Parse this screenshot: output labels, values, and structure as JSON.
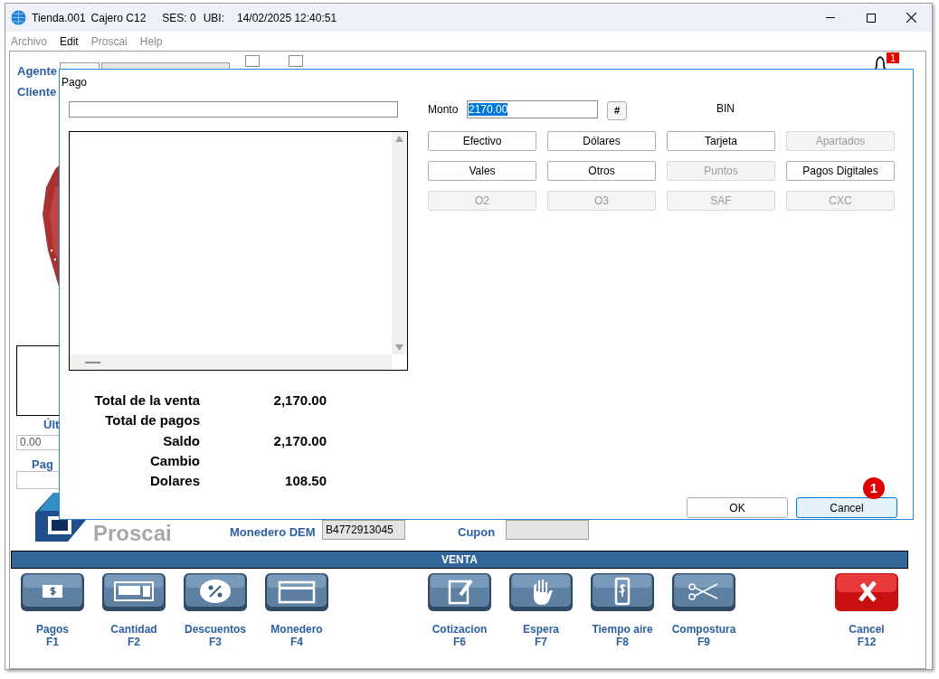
{
  "window": {
    "title_parts": [
      "Tienda.001",
      "Cajero C12",
      "SES: 0",
      "UBI:",
      "14/02/2025 12:40:51"
    ]
  },
  "menu": [
    {
      "label": "Archivo",
      "disabled": true
    },
    {
      "label": "Edit",
      "disabled": false
    },
    {
      "label": "Proscai",
      "disabled": true
    },
    {
      "label": "Help",
      "disabled": true
    }
  ],
  "header": {
    "agente_label": "Agente",
    "cliente_label": "Cliente",
    "notification_count": "1",
    "checkboxes": [
      {
        "checked": false
      },
      {
        "checked": false
      }
    ]
  },
  "side": {
    "ultimo_label": "Últ",
    "ultimo_value": "0.00",
    "pago_label": "Pag"
  },
  "logo": {
    "text": "Proscai"
  },
  "footer_fields": [
    {
      "label": "Monedero DEM",
      "value": "B4772913045"
    },
    {
      "label": "Cupon"
    }
  ],
  "section_title": "VENTA",
  "function_keys": [
    {
      "kind": "cash",
      "label": "Pagos",
      "key": "F1"
    },
    {
      "kind": "calculator",
      "label": "Cantidad",
      "key": "F2"
    },
    {
      "kind": "percent",
      "label": "Descuentos",
      "key": "F3"
    },
    {
      "kind": "card",
      "label": "Monedero",
      "key": "F4"
    },
    {
      "kind": "gap"
    },
    {
      "kind": "note",
      "label": "Cotizacion",
      "key": "F6"
    },
    {
      "kind": "hand",
      "label": "Espera",
      "key": "F7"
    },
    {
      "kind": "phone",
      "label": "Tiempo aire",
      "key": "F8"
    },
    {
      "kind": "scissors",
      "label": "Compostura",
      "key": "F9"
    },
    {
      "kind": "gap"
    },
    {
      "kind": "cancel",
      "label": "Cancel",
      "key": "F12"
    }
  ],
  "dialog": {
    "title": "Pago",
    "amount": {
      "label": "Monto",
      "value": "2170.00",
      "selected": true
    },
    "hash_button": "#",
    "bin_label": "BIN",
    "methods": [
      {
        "label": "Efectivo",
        "disabled": false
      },
      {
        "label": "Dólares",
        "disabled": false
      },
      {
        "label": "Tarjeta",
        "disabled": false
      },
      {
        "label": "Apartados",
        "disabled": true
      },
      {
        "label": "Vales",
        "disabled": false
      },
      {
        "label": "Otros",
        "disabled": false
      },
      {
        "label": "Puntos",
        "disabled": true
      },
      {
        "label": "Pagos Digitales",
        "disabled": false
      },
      {
        "label": "O2",
        "disabled": true
      },
      {
        "label": "O3",
        "disabled": true
      },
      {
        "label": "SAF",
        "disabled": true
      },
      {
        "label": "CXC",
        "disabled": true
      }
    ],
    "totals": [
      {
        "label": "Total de la venta",
        "value": "2,170.00"
      },
      {
        "label": "Total de pagos"
      },
      {
        "label": "Saldo",
        "value": "2,170.00"
      },
      {
        "label": "Cambio"
      },
      {
        "label": "Dolares",
        "value": "108.50"
      }
    ],
    "buttons": [
      {
        "label": "OK",
        "focused": false
      },
      {
        "label": "Cancel",
        "focused": true
      }
    ],
    "marker": "1"
  }
}
